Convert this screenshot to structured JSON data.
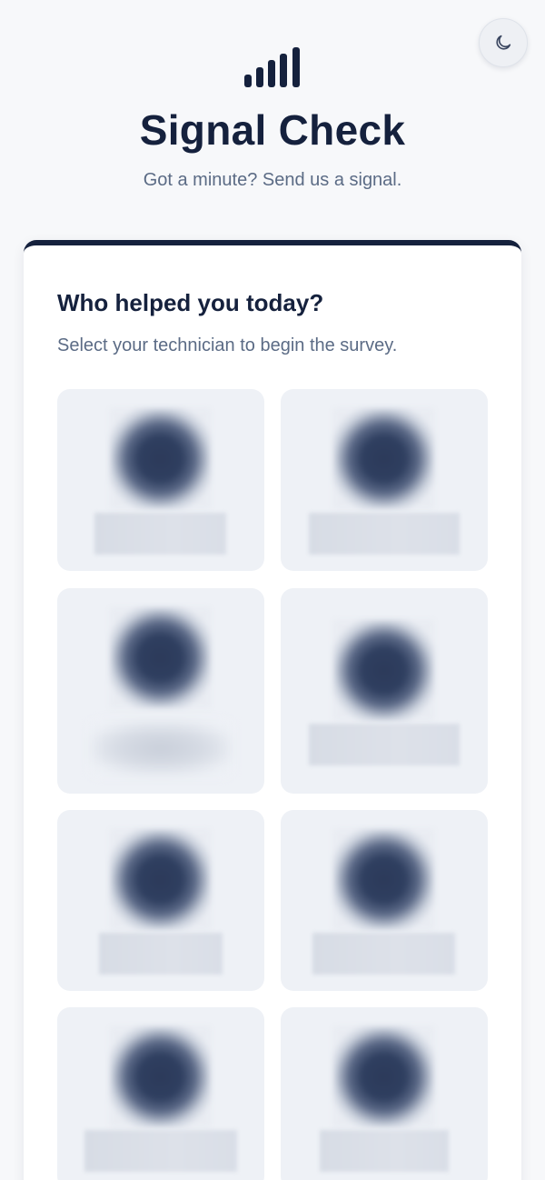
{
  "header": {
    "title": "Signal Check",
    "subtitle": "Got a minute? Send us a signal.",
    "logo_icon": "signal-bars-icon",
    "theme_toggle_icon": "moon-icon"
  },
  "survey": {
    "heading": "Who helped you today?",
    "instructions": "Select your technician to begin the survey."
  },
  "technicians_note": "technician photos and names are blurred in the screenshot",
  "colors": {
    "primary": "#15213d",
    "muted_text": "#5b6b85",
    "page_bg": "#f7f8fa",
    "tile_bg": "#eef1f6"
  }
}
